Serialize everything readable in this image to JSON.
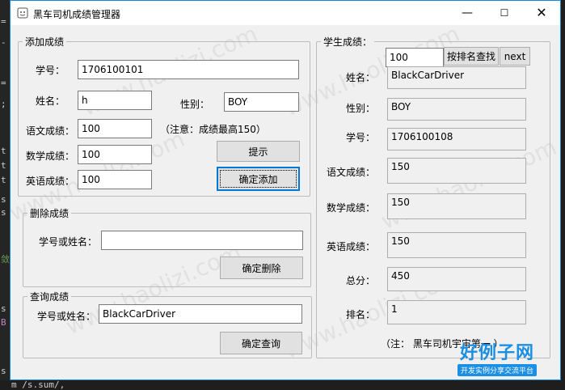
{
  "window": {
    "title": "黑车司机成绩管理器"
  },
  "background": {
    "left_code_fragments": [
      "=",
      "-",
      "=",
      ";",
      "t",
      "t",
      "t",
      "s",
      "s",
      "敛",
      "s",
      "B",
      "s"
    ],
    "bottom_code": "m /s.sum/,"
  },
  "add_group": {
    "legend": "添加成绩",
    "student_id_label": "学号：",
    "student_id_value": "1706100101",
    "name_label": "姓名：",
    "name_value": "h",
    "gender_label": "性别：",
    "gender_value": "BOY",
    "chinese_label": "语文成绩：",
    "chinese_value": "100",
    "note": "（注意：成绩最高150）",
    "math_label": "数学成绩：",
    "math_value": "100",
    "english_label": "英语成绩：",
    "english_value": "100",
    "hint_button": "提示",
    "confirm_add_button": "确定添加"
  },
  "delete_group": {
    "legend": "删除成绩",
    "key_label": "学号或姓名：",
    "key_value": "",
    "confirm_delete_button": "确定删除"
  },
  "query_group": {
    "legend": "查询成绩",
    "key_label": "学号或姓名：",
    "key_value": "BlackCarDriver",
    "confirm_query_button": "确定查询"
  },
  "student_group": {
    "legend": "学生成绩：",
    "rank_input_value": "100",
    "search_by_rank_button": "按排名查找",
    "next_button": "next",
    "name_label": "姓名：",
    "name_value": "BlackCarDriver",
    "gender_label": "性别：",
    "gender_value": "BOY",
    "student_id_label": "学号：",
    "student_id_value": "1706100108",
    "chinese_label": "语文成绩：",
    "chinese_value": "150",
    "math_label": "数学成绩：",
    "math_value": "150",
    "english_label": "英语成绩：",
    "english_value": "150",
    "total_label": "总分：",
    "total_value": "450",
    "rank_label": "排名：",
    "rank_value": "1",
    "note": "（注：   黑车司机宇宙第一 ）"
  },
  "watermark": {
    "text": "www.haolizi.com",
    "logo_text": "好例子网",
    "logo_subtext": "开发实例分享交流平台"
  },
  "colors": {
    "accent": "#0078d7",
    "window_border": "#1883d7",
    "logo_blue": "#1a8fe3"
  },
  "icons": {
    "app": "app-window-icon",
    "minimize": "minimize-icon",
    "maximize": "maximize-icon",
    "close": "close-icon"
  }
}
